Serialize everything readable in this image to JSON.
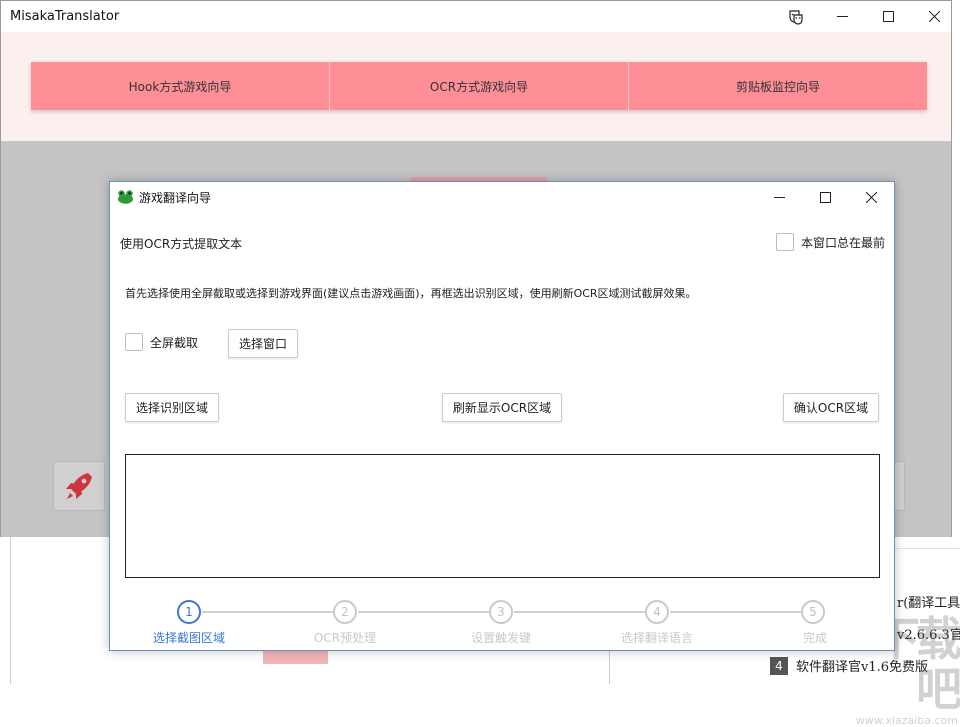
{
  "app": {
    "title": "MisakaTranslator",
    "wizard_buttons": [
      "Hook方式游戏向导",
      "OCR方式游戏向导",
      "剪贴板监控向导"
    ]
  },
  "dialog": {
    "title": "游戏翻译向导",
    "subtitle": "使用OCR方式提取文本",
    "topmost_label": "本窗口总在最前",
    "instruction": "首先选择使用全屏截取或选择到游戏界面(建议点击游戏画面)，再框选出识别区域，使用刷新OCR区域测试截屏效果。",
    "fullscreen_label": "全屏截取",
    "select_window_button": "选择窗口",
    "select_region_button": "选择识别区域",
    "refresh_button": "刷新显示OCR区域",
    "confirm_button": "确认OCR区域",
    "steps": [
      {
        "num": "1",
        "label": "选择截图区域",
        "active": true
      },
      {
        "num": "2",
        "label": "OCR预处理",
        "active": false
      },
      {
        "num": "3",
        "label": "设置触发键",
        "active": false
      },
      {
        "num": "4",
        "label": "选择翻译语言",
        "active": false
      },
      {
        "num": "5",
        "label": "完成",
        "active": false
      }
    ]
  },
  "background": {
    "row1": "r(翻译工具",
    "row2": "v2.6.6.3官",
    "row3_num": "4",
    "row3_text": "软件翻译官v1.6免费版",
    "watermark": "下载吧",
    "watermark_url": "www.xiazaiba.com"
  },
  "colors": {
    "wizard_button": "#ff8f97",
    "accent_blue": "#3a78d4",
    "overlay_gray": "#c4c4c4",
    "pink_band": "#fcf0ee"
  }
}
